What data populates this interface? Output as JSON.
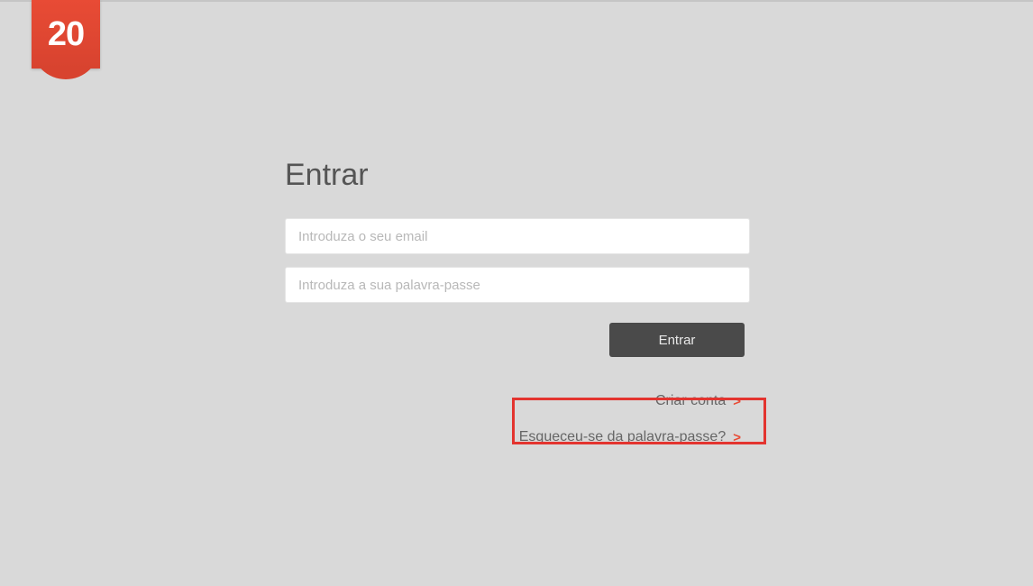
{
  "logo": {
    "text": "20"
  },
  "login": {
    "title": "Entrar",
    "email_placeholder": "Introduza o seu email",
    "password_placeholder": "Introduza a sua palavra-passe",
    "submit_label": "Entrar"
  },
  "links": {
    "create_account": "Criar conta",
    "forgot_password": "Esqueceu-se da palavra-passe?"
  },
  "colors": {
    "accent": "#e84b35",
    "button": "#4a4a4a",
    "background": "#d9d9d9",
    "highlight": "#e3342f"
  }
}
